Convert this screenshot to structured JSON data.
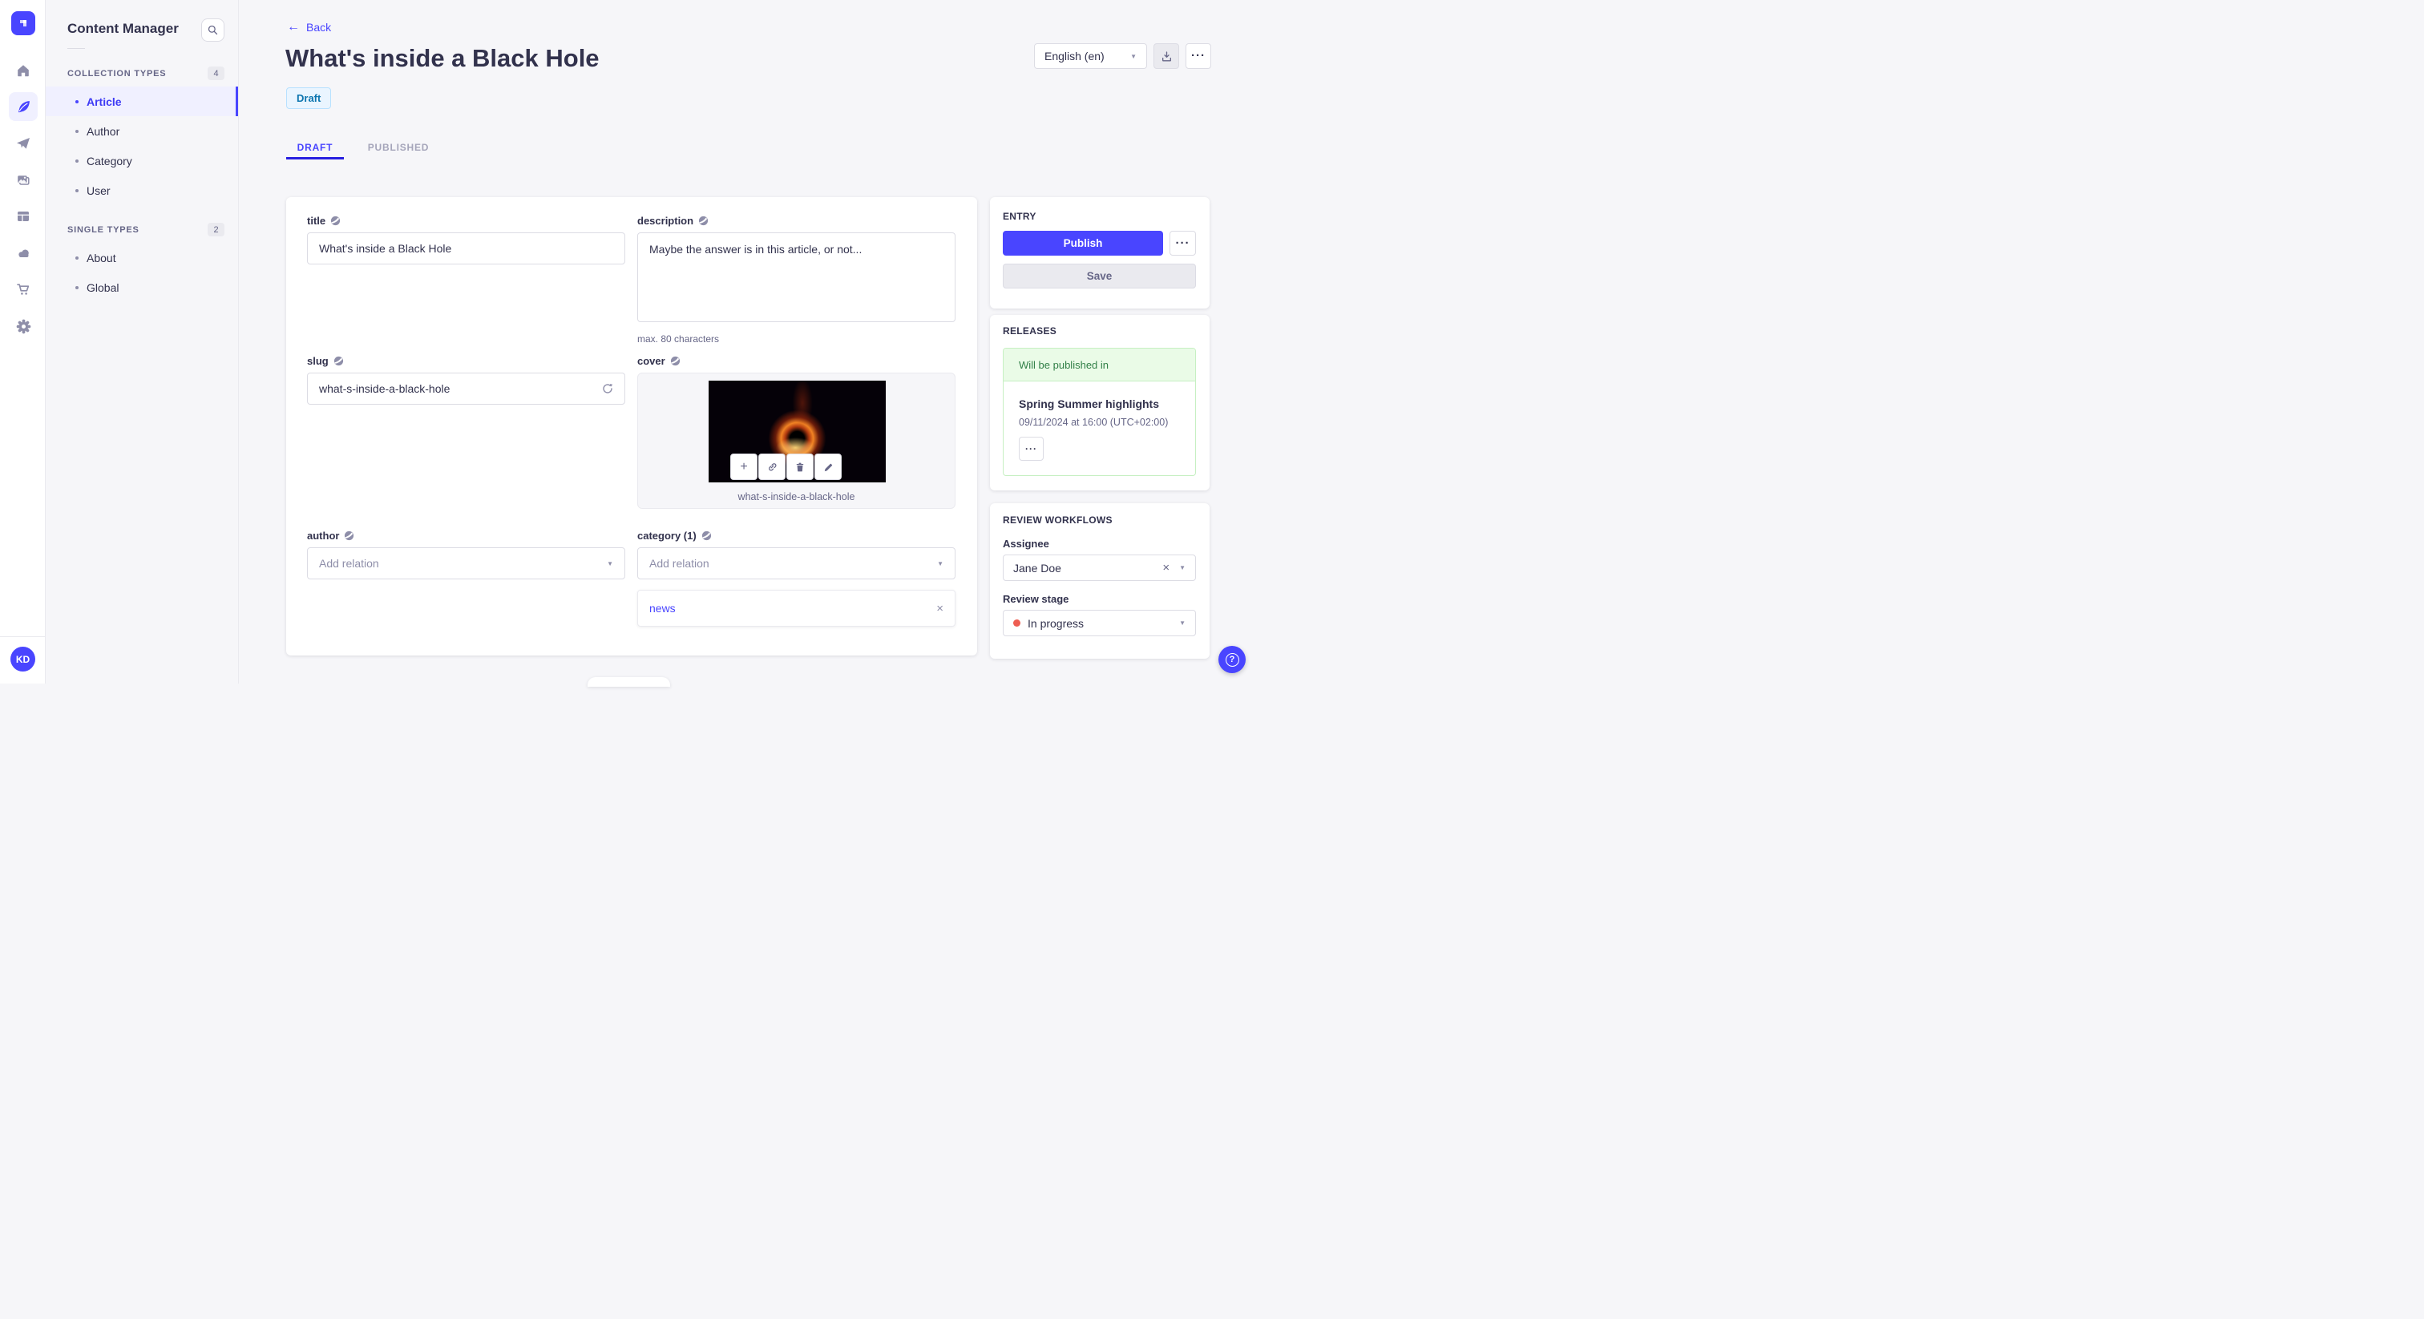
{
  "icons": {
    "back_arrow": "←",
    "ellipsis": "···",
    "caret_down": "▼",
    "close": "×",
    "plus": "+",
    "help": "?"
  },
  "colors": {
    "primary": "#4945ff",
    "primary_active_bg": "#f0f0ff",
    "page_bg": "#f6f6f9",
    "border": "#dcdce4",
    "text_dark": "#32324d",
    "text_muted": "#666687",
    "placeholder": "#8e8ea9",
    "draft_bg": "#eaf5ff",
    "draft_border": "#b8e1ff",
    "draft_text": "#0c75af",
    "success_bg": "#eafbe7",
    "success_border": "#c6f0c2",
    "success_text": "#328048",
    "danger_dot": "#ee5e52"
  },
  "rail": {
    "avatar_initials": "KD",
    "nav_icons": [
      "strapi-logo",
      "home",
      "content-manager-feather",
      "paper-plane",
      "media-library",
      "layout",
      "cloud",
      "marketplace-cart",
      "settings-gear"
    ]
  },
  "subnav": {
    "title": "Content Manager",
    "sections": [
      {
        "label": "COLLECTION TYPES",
        "count": "4",
        "items": [
          {
            "label": "Article"
          },
          {
            "label": "Author"
          },
          {
            "label": "Category"
          },
          {
            "label": "User"
          }
        ]
      },
      {
        "label": "SINGLE TYPES",
        "count": "2",
        "items": [
          {
            "label": "About"
          },
          {
            "label": "Global"
          }
        ]
      }
    ]
  },
  "header": {
    "back_label": "Back",
    "title": "What's inside a Black Hole",
    "status_badge": "Draft",
    "locale_select": "English (en)",
    "tabs": [
      {
        "label": "DRAFT"
      },
      {
        "label": "PUBLISHED"
      }
    ]
  },
  "form": {
    "title": {
      "label": "title",
      "value": "What's inside a Black Hole"
    },
    "description": {
      "label": "description",
      "value": "Maybe the answer is in this article, or not...",
      "hint": "max. 80 characters"
    },
    "slug": {
      "label": "slug",
      "value": "what-s-inside-a-black-hole"
    },
    "cover": {
      "label": "cover",
      "caption": "what-s-inside-a-black-hole"
    },
    "author": {
      "label": "author",
      "placeholder": "Add relation"
    },
    "category": {
      "label": "category (1)",
      "placeholder": "Add relation",
      "relations": [
        {
          "label": "news"
        }
      ]
    }
  },
  "entry_panel": {
    "heading": "ENTRY",
    "publish_label": "Publish",
    "save_label": "Save"
  },
  "releases_panel": {
    "heading": "RELEASES",
    "status": "Will be published in",
    "release_title": "Spring Summer highlights",
    "release_date": "09/11/2024 at 16:00 (UTC+02:00)"
  },
  "review_panel": {
    "heading": "REVIEW WORKFLOWS",
    "assignee_label": "Assignee",
    "assignee_value": "Jane Doe",
    "stage_label": "Review stage",
    "stage_value": "In progress"
  }
}
